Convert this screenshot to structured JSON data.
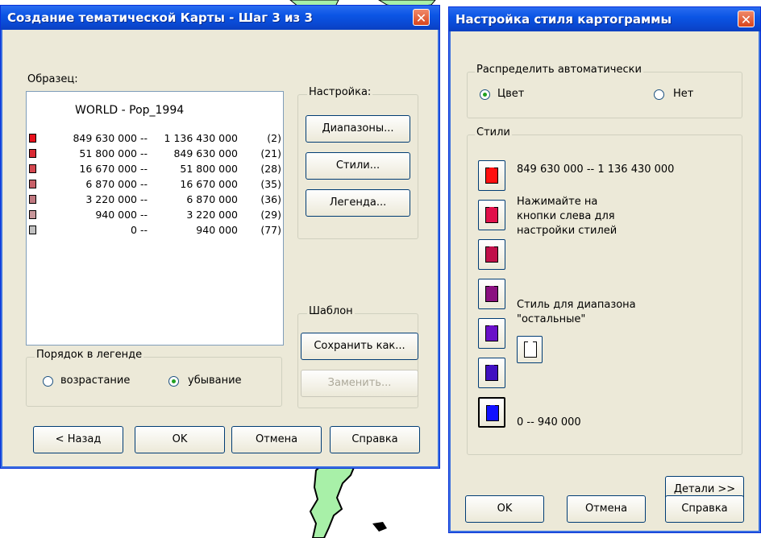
{
  "dialog1": {
    "title": "Создание тематической Карты - Шаг 3 из 3",
    "sample_label": "Образец:",
    "legend_title": "WORLD - Pop_1994",
    "ranges": [
      {
        "from": "849 630 000 --",
        "to": "1 136 430 000",
        "count": "(2)",
        "color": "#e8101c"
      },
      {
        "from": "51 800 000 --",
        "to": "849 630 000",
        "count": "(21)",
        "color": "#d92a34"
      },
      {
        "from": "16 670 000 --",
        "to": "51 800 000",
        "count": "(28)",
        "color": "#d4474f"
      },
      {
        "from": "6 870 000 --",
        "to": "16 670 000",
        "count": "(35)",
        "color": "#c86068"
      },
      {
        "from": "3 220 000 --",
        "to": "6 870 000",
        "count": "(36)",
        "color": "#c07880"
      },
      {
        "from": "940 000 --",
        "to": "3 220 000",
        "count": "(29)",
        "color": "#c8969a"
      },
      {
        "from": "0 --",
        "to": "940 000",
        "count": "(77)",
        "color": "#c0c0c0"
      }
    ],
    "settings_group": "Настройка:",
    "ranges_button": "Диапазоны...",
    "styles_button": "Стили...",
    "legend_button": "Легенда...",
    "template_group": "Шаблон",
    "save_as_button": "Сохранить как...",
    "replace_button": "Заменить...",
    "order_group": "Порядок в легенде",
    "ascending_label": "возрастание",
    "descending_label": "убывание",
    "back_button": "< Назад",
    "ok_button": "OK",
    "cancel_button": "Отмена",
    "help_button": "Справка"
  },
  "dialog2": {
    "title": "Настройка стиля картограммы",
    "auto_group": "Распределить автоматически",
    "color_label": "Цвет",
    "none_label": "Нет",
    "styles_group": "Стили",
    "top_range": "849 630 000 -- 1 136 430 000",
    "hint": [
      "Нажимайте на",
      "кнопки слева для",
      "настройки стилей"
    ],
    "other_label": [
      "Стиль для диапазона",
      "\"остальные\""
    ],
    "bottom_range": "0 -- 940 000",
    "style_colors": [
      "#ff1010",
      "#e0104a",
      "#c0104a",
      "#8a1080",
      "#6a10c8",
      "#4010c0",
      "#1010ff"
    ],
    "details_button": "Детали >>",
    "ok_button": "OK",
    "cancel_button": "Отмена",
    "help_button": "Справка"
  }
}
